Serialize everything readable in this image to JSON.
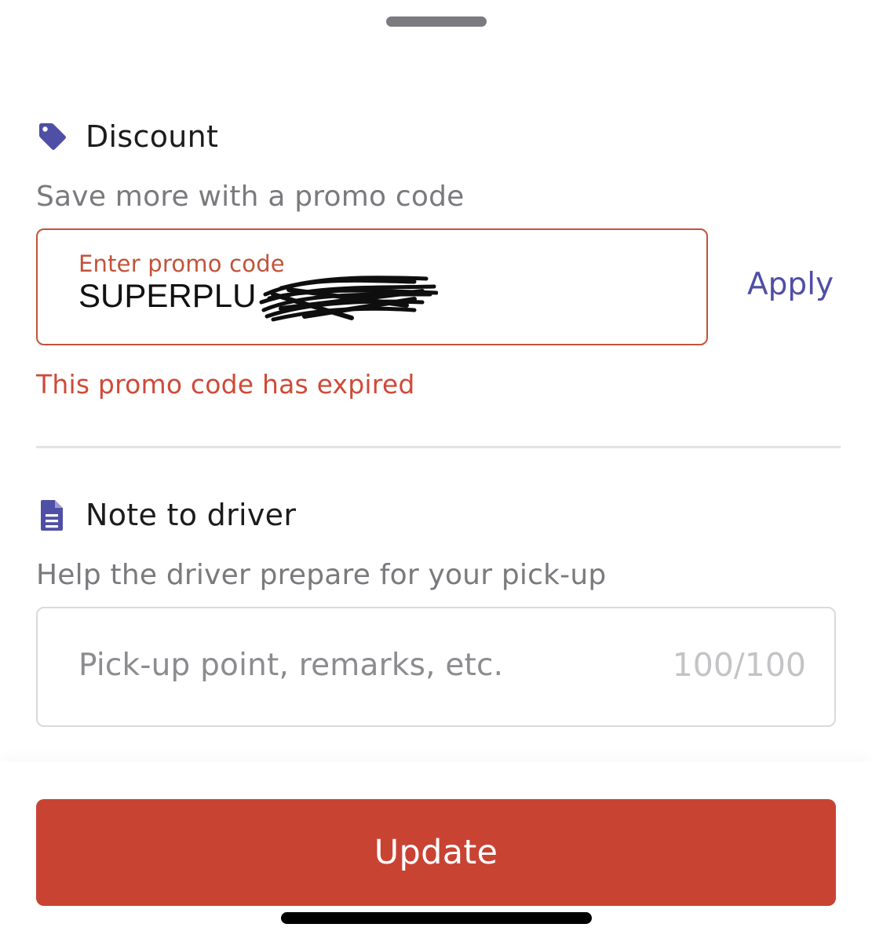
{
  "discount": {
    "icon": "tag-icon",
    "title": "Discount",
    "subtitle": "Save more with a promo code",
    "promo_label": "Enter promo code",
    "promo_value": "SUPERPLU",
    "apply_label": "Apply",
    "error_text": "This promo code has expired"
  },
  "note": {
    "icon": "document-icon",
    "title": "Note to driver",
    "subtitle": "Help the driver prepare for your pick-up",
    "placeholder": "Pick-up point, remarks, etc.",
    "counter": "100/100"
  },
  "footer": {
    "update_label": "Update"
  },
  "colors": {
    "accent": "#4f4fa6",
    "error": "#d04a38",
    "primary_button": "#c94333"
  }
}
